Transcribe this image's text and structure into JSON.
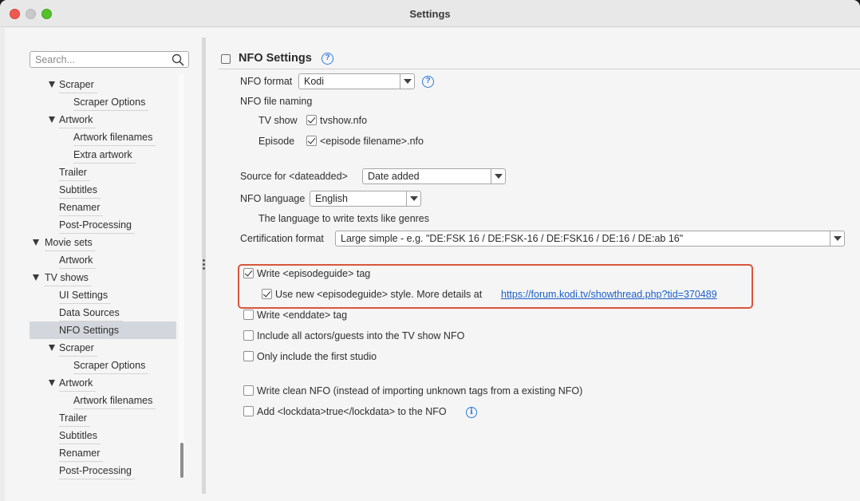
{
  "window": {
    "title": "Settings"
  },
  "search": {
    "placeholder": "Search..."
  },
  "tree": [
    {
      "label": "Scraper",
      "expanded": true
    },
    {
      "label": "Scraper Options"
    },
    {
      "label": "Artwork",
      "expanded": true
    },
    {
      "label": "Artwork filenames"
    },
    {
      "label": "Extra artwork"
    },
    {
      "label": "Trailer"
    },
    {
      "label": "Subtitles"
    },
    {
      "label": "Renamer"
    },
    {
      "label": "Post-Processing"
    },
    {
      "label": "Movie sets",
      "expanded": true
    },
    {
      "label": "Artwork"
    },
    {
      "label": "TV shows",
      "expanded": true
    },
    {
      "label": "UI Settings"
    },
    {
      "label": "Data Sources"
    },
    {
      "label": "NFO Settings",
      "selected": true
    },
    {
      "label": "Scraper",
      "expanded": true
    },
    {
      "label": "Scraper Options"
    },
    {
      "label": "Artwork",
      "expanded": true
    },
    {
      "label": "Artwork filenames"
    },
    {
      "label": "Trailer"
    },
    {
      "label": "Subtitles"
    },
    {
      "label": "Renamer"
    },
    {
      "label": "Post-Processing"
    }
  ],
  "panel": {
    "title": "NFO Settings",
    "nfo_format": {
      "label": "NFO format",
      "value": "Kodi"
    },
    "nfo_file_naming": {
      "label": "NFO file naming"
    },
    "tv_show": {
      "label": "TV show",
      "checked": true,
      "value": "tvshow.nfo"
    },
    "episode": {
      "label": "Episode",
      "checked": true,
      "value": "<episode filename>.nfo"
    },
    "dateadded": {
      "label": "Source for <dateadded>",
      "value": "Date added"
    },
    "nfo_language": {
      "label": "NFO language",
      "value": "English",
      "hint": "The language to write texts like genres"
    },
    "certification": {
      "label": "Certification format",
      "value": "Large simple - e.g. \"DE:FSK 16 / DE:FSK-16 / DE:FSK16 / DE:16 / DE:ab 16\""
    },
    "episodeguide": {
      "label": "Write <episodeguide> tag",
      "checked": true
    },
    "new_episodeguide": {
      "label": "Use new <episodeguide> style. More details at",
      "link": "https://forum.kodi.tv/showthread.php?tid=370489",
      "checked": true
    },
    "enddate": {
      "label": "Write <enddate> tag",
      "checked": false
    },
    "all_actors": {
      "label": "Include all actors/guests into the TV show NFO",
      "checked": false
    },
    "first_studio": {
      "label": "Only include the first studio",
      "checked": false
    },
    "clean_nfo": {
      "label": "Write clean NFO (instead of importing unknown tags from a existing NFO)",
      "checked": false
    },
    "lockdata": {
      "label": "Add <lockdata>true</lockdata> to the NFO",
      "checked": false
    }
  },
  "colors": {
    "highlight": "#d9553b",
    "link": "#1a5fc9",
    "selected_row": "#d3d7dd"
  }
}
